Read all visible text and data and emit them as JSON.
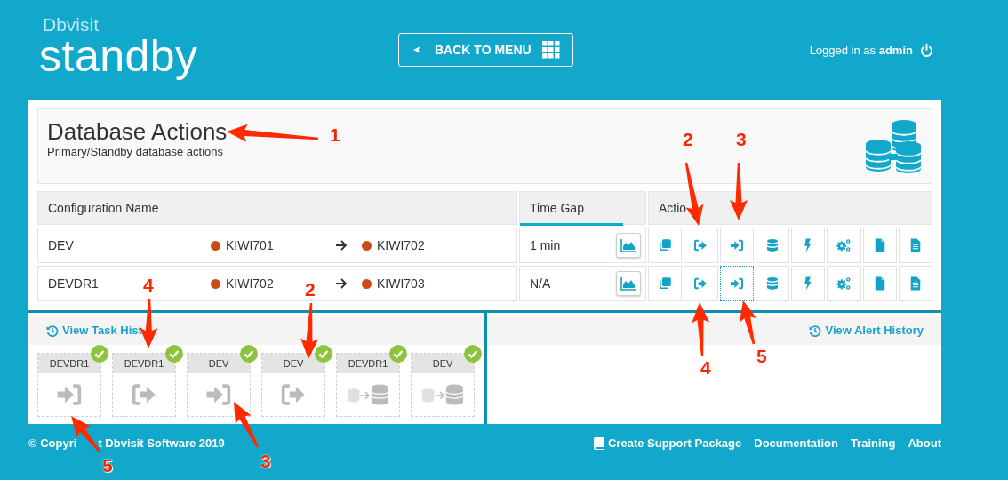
{
  "header": {
    "logo_top": "Dbvisit",
    "logo_main": "standby",
    "back_button": {
      "label": "BACK TO MENU"
    },
    "user": {
      "prefix": "Logged in as",
      "name": "admin"
    }
  },
  "page": {
    "title": "Database Actions",
    "subtitle": "Primary/Standby database actions"
  },
  "table": {
    "columns": [
      {
        "label": "Configuration Name",
        "selected": false
      },
      {
        "label": "Time Gap",
        "selected": true
      },
      {
        "label": "Actio",
        "selected": false
      }
    ],
    "rows": [
      {
        "name": "DEV",
        "primary": {
          "name": "KIWI701",
          "color": "#cc4a14"
        },
        "standby": {
          "name": "KIWI702",
          "color": "#cc4a14"
        },
        "time_gap": "1 min",
        "actions": [
          {
            "kind": "copy",
            "focused": false
          },
          {
            "kind": "switchover",
            "focused": false
          },
          {
            "kind": "failover",
            "focused": false
          },
          {
            "kind": "database",
            "focused": false
          },
          {
            "kind": "bolt",
            "focused": false
          },
          {
            "kind": "gears",
            "focused": false
          },
          {
            "kind": "file",
            "focused": false
          },
          {
            "kind": "document",
            "focused": false
          }
        ]
      },
      {
        "name": "DEVDR1",
        "primary": {
          "name": "KIWI702",
          "color": "#cc4a14"
        },
        "standby": {
          "name": "KIWI703",
          "color": "#cc4a14"
        },
        "time_gap": "N/A",
        "actions": [
          {
            "kind": "copy",
            "focused": false
          },
          {
            "kind": "switchover",
            "focused": false
          },
          {
            "kind": "failover",
            "focused": true
          },
          {
            "kind": "database",
            "focused": false
          },
          {
            "kind": "bolt",
            "focused": false
          },
          {
            "kind": "gears",
            "focused": false
          },
          {
            "kind": "file",
            "focused": false
          },
          {
            "kind": "document",
            "focused": false
          }
        ]
      }
    ]
  },
  "task_history": {
    "link": "View Task Hist",
    "tasks": [
      {
        "label": "DEVDR1",
        "kind": "failover",
        "done": true
      },
      {
        "label": "DEVDR1",
        "kind": "switchover",
        "done": true
      },
      {
        "label": "DEV",
        "kind": "failover",
        "done": true
      },
      {
        "label": "DEV",
        "kind": "switchover",
        "done": true
      },
      {
        "label": "DEVDR1",
        "kind": "transfer",
        "done": true
      },
      {
        "label": "DEV",
        "kind": "transfer",
        "done": true
      }
    ]
  },
  "alert_history": {
    "link": "View Alert History"
  },
  "footer": {
    "copyright_parts": [
      "© Copyri",
      "t Dbvisit Software 2019"
    ],
    "links": [
      {
        "label": "Create Support Package",
        "kind": "book"
      },
      {
        "label": "Documentation",
        "kind": "plain"
      },
      {
        "label": "Training",
        "kind": "plain"
      },
      {
        "label": "About",
        "kind": "plain"
      }
    ]
  },
  "annotations": [
    {
      "label": "1"
    },
    {
      "label": "2"
    },
    {
      "label": "3"
    },
    {
      "label": "4"
    },
    {
      "label": "2"
    },
    {
      "label": "4"
    },
    {
      "label": "5"
    },
    {
      "label": "5"
    },
    {
      "label": "3"
    }
  ]
}
